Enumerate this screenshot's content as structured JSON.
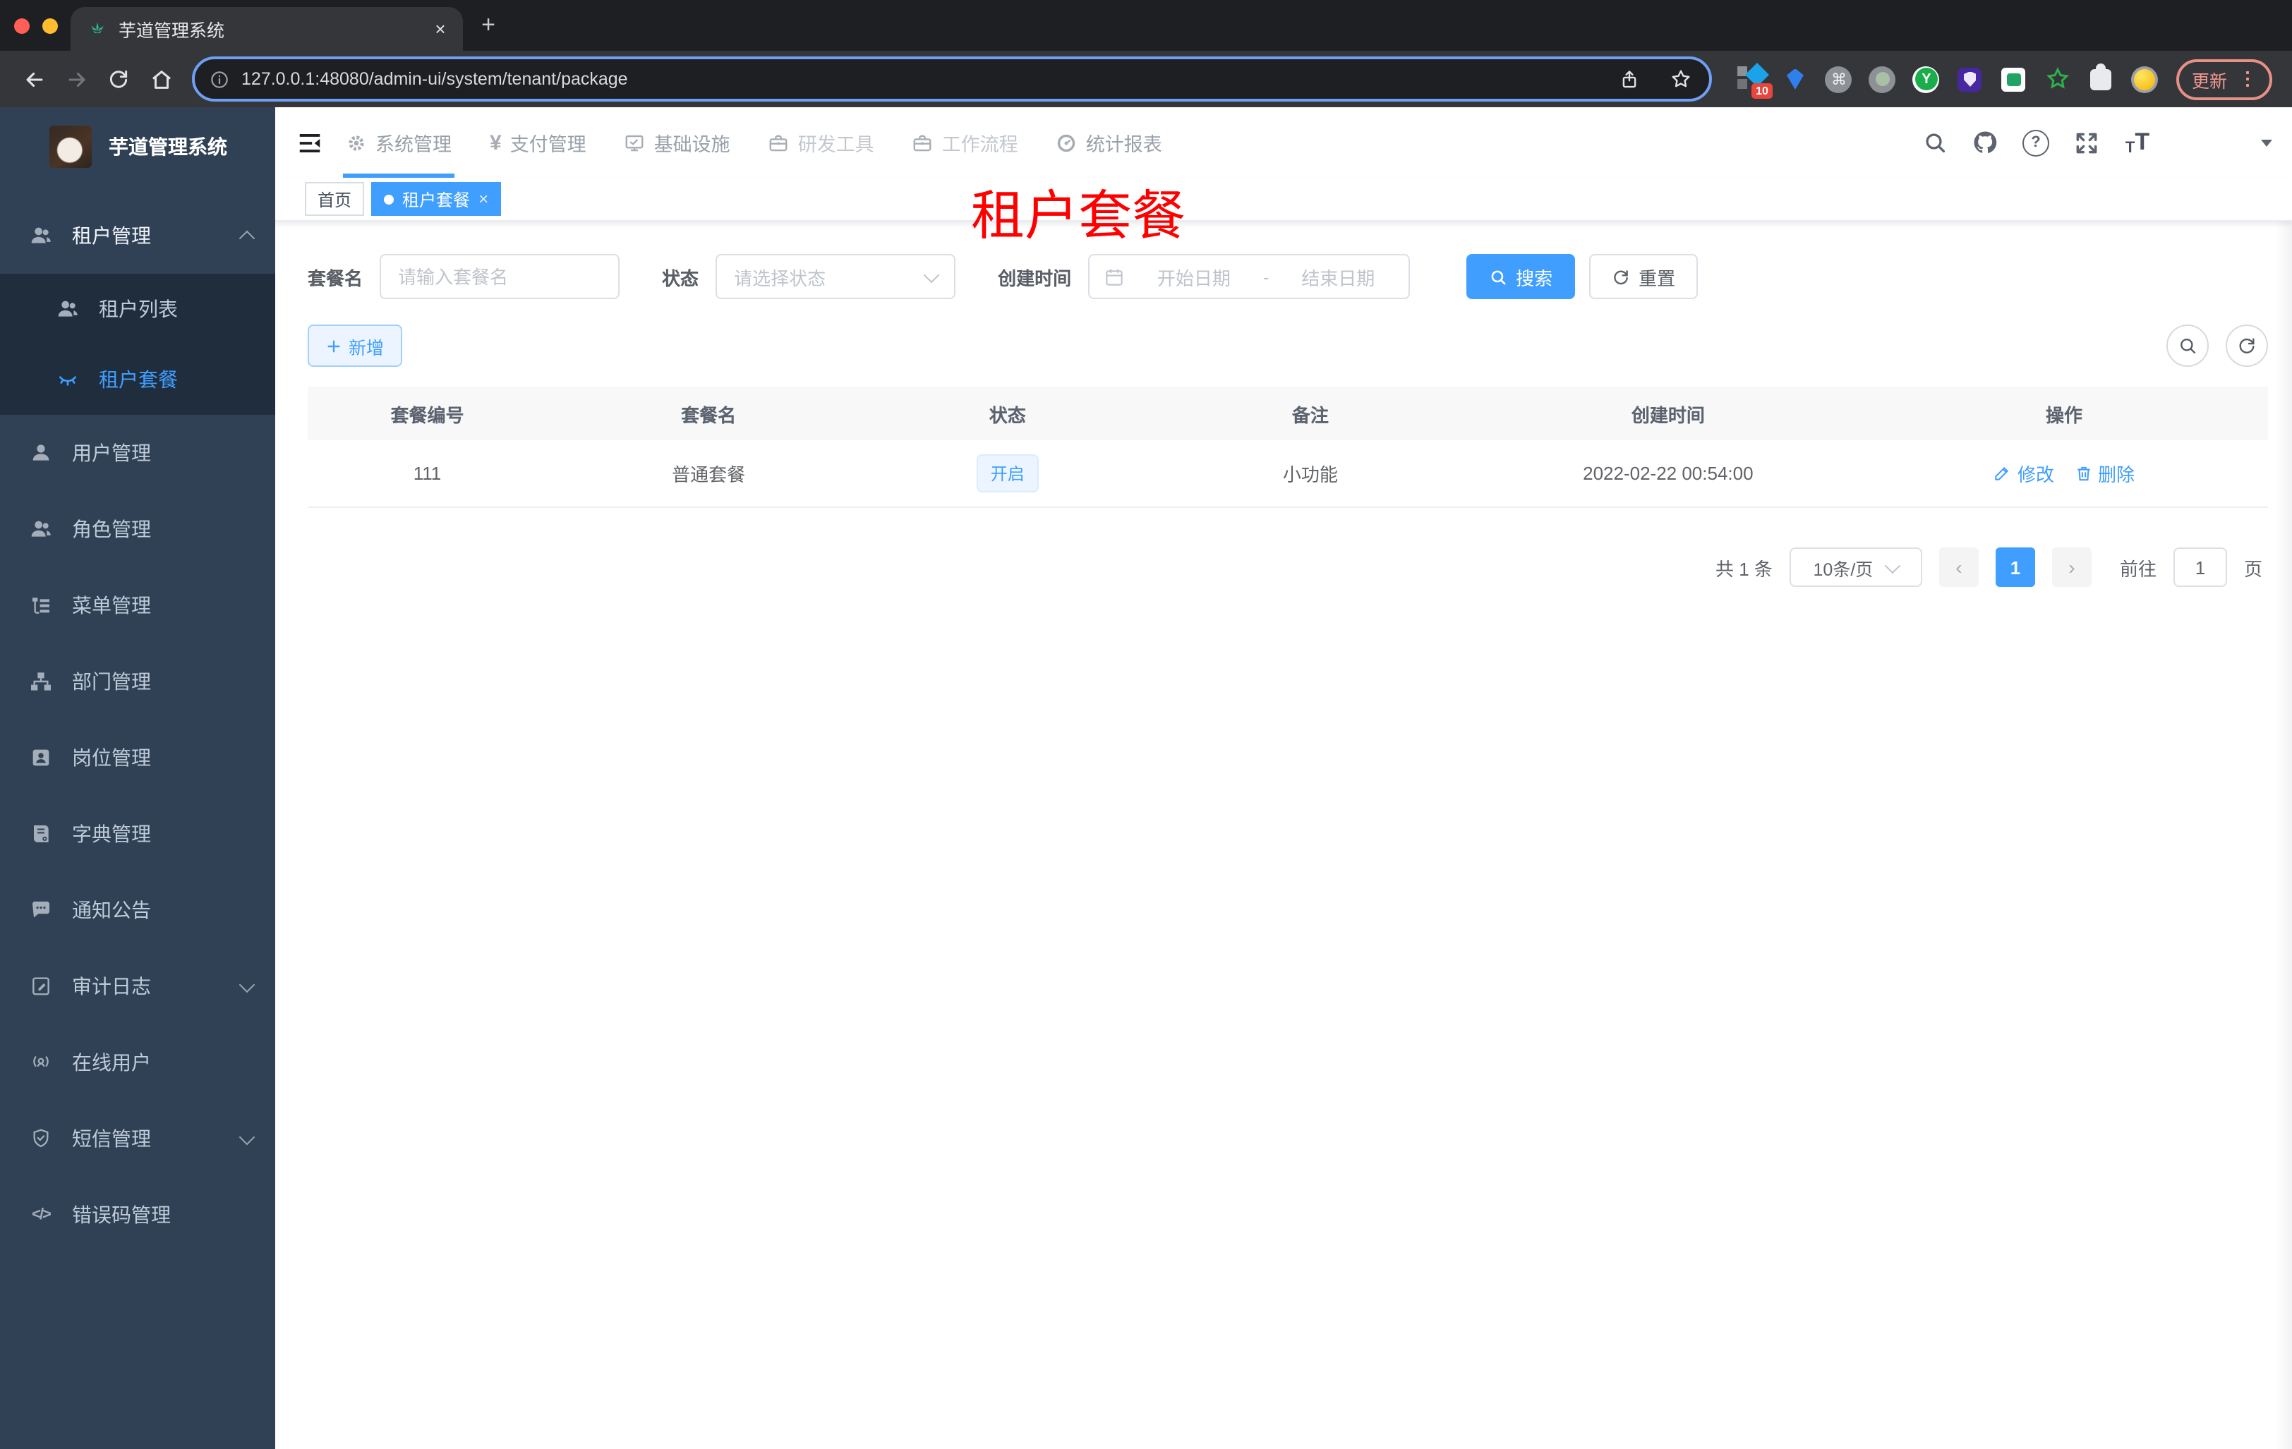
{
  "colors": {
    "primary": "#409eff",
    "sidebar_bg": "#304156",
    "submenu_bg": "#1f2d3d",
    "red_title": "#ff0000",
    "tag_active": "#409eff"
  },
  "browser": {
    "tab_title": "芋道管理系统",
    "url": "127.0.0.1:48080/admin-ui/system/tenant/package",
    "update_label": "更新",
    "ext_badge": "10",
    "ext_letter": "Y"
  },
  "glyphs": {
    "close": "×",
    "plus_tab": "+",
    "more": "⋮",
    "command": "⌘",
    "yen": "¥",
    "code": "</>",
    "help": "?",
    "font_small": "T",
    "font_large": "T",
    "prev": "‹",
    "next": "›",
    "dot_sep": "-"
  },
  "sidebar": {
    "logo_title": "芋道管理系统",
    "items": [
      {
        "label": "租户管理",
        "icon": "peoples-icon"
      },
      {
        "label": "租户列表",
        "icon": "peoples-icon"
      },
      {
        "label": "租户套餐",
        "icon": "eye-closed-icon"
      },
      {
        "label": "用户管理",
        "icon": "user-icon"
      },
      {
        "label": "角色管理",
        "icon": "peoples-icon"
      },
      {
        "label": "菜单管理",
        "icon": "tree-table-icon"
      },
      {
        "label": "部门管理",
        "icon": "org-tree-icon"
      },
      {
        "label": "岗位管理",
        "icon": "badge-icon"
      },
      {
        "label": "字典管理",
        "icon": "dict-icon"
      },
      {
        "label": "通知公告",
        "icon": "message-icon"
      },
      {
        "label": "审计日志",
        "icon": "log-icon"
      },
      {
        "label": "在线用户",
        "icon": "online-icon"
      },
      {
        "label": "短信管理",
        "icon": "shield-icon"
      },
      {
        "label": "错误码管理",
        "icon": "code-icon"
      }
    ]
  },
  "topnav": {
    "items": [
      {
        "label": "系统管理",
        "icon": "gear-icon"
      },
      {
        "label": "支付管理",
        "icon": "yen-icon"
      },
      {
        "label": "基础设施",
        "icon": "monitor-icon"
      },
      {
        "label": "研发工具",
        "icon": "briefcase-icon"
      },
      {
        "label": "工作流程",
        "icon": "briefcase-icon"
      },
      {
        "label": "统计报表",
        "icon": "dashboard-icon"
      }
    ]
  },
  "tags": {
    "home": "首页",
    "active": "租户套餐"
  },
  "page_title_overlay": "租户套餐",
  "filters": {
    "name_label": "套餐名",
    "name_placeholder": "请输入套餐名",
    "status_label": "状态",
    "status_placeholder": "请选择状态",
    "date_label": "创建时间",
    "date_start_placeholder": "开始日期",
    "date_separator": "-",
    "date_end_placeholder": "结束日期",
    "search_label": "搜索",
    "reset_label": "重置"
  },
  "toolbar": {
    "add_label": "新增"
  },
  "table": {
    "columns": [
      "套餐编号",
      "套餐名",
      "状态",
      "备注",
      "创建时间",
      "操作"
    ],
    "rows": [
      {
        "id": "111",
        "name": "普通套餐",
        "status": "开启",
        "remark": "小功能",
        "created": "2022-02-22 00:54:00",
        "actions": {
          "edit": "修改",
          "delete": "删除"
        }
      }
    ]
  },
  "pagination": {
    "total": "共 1 条",
    "page_size": "10条/页",
    "page": "1",
    "goto_label": "前往",
    "goto_value": "1",
    "unit_label": "页"
  }
}
